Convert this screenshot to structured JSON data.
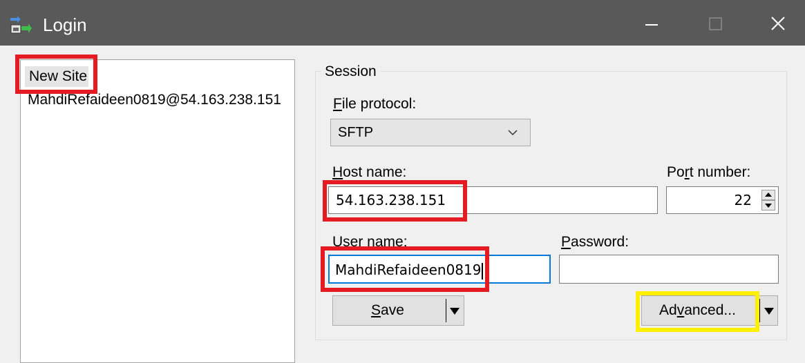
{
  "window": {
    "title": "Login",
    "app_icon": "winscp-login-icon",
    "controls": [
      "minimize-icon",
      "maximize-icon",
      "close-icon"
    ]
  },
  "sites": {
    "new_site_label": "New Site",
    "saved_site_label": "MahdiRefaideen0819@54.163.238.151"
  },
  "session": {
    "legend": "Session",
    "file_protocol_label_prefix": "F",
    "file_protocol_label_rest": "ile protocol:",
    "file_protocol_value": "SFTP",
    "host_label_prefix": "H",
    "host_label_rest": "ost name:",
    "host_value": "54.163.238.151",
    "port_label_a": "Po",
    "port_label_u": "r",
    "port_label_b": "t number:",
    "port_value": "22",
    "user_label_prefix": "U",
    "user_label_rest": "ser name:",
    "user_value": "MahdiRefaideen0819",
    "password_label_prefix": "P",
    "password_label_rest": "assword:",
    "password_value": ""
  },
  "buttons": {
    "save_prefix": "S",
    "save_rest": "ave",
    "advanced_a": "Ad",
    "advanced_u": "v",
    "advanced_b": "anced..."
  },
  "colors": {
    "titlebar": "#595959",
    "highlight_red": "#e41b23",
    "highlight_yellow": "#ffef00",
    "focus_border": "#0078d7"
  }
}
